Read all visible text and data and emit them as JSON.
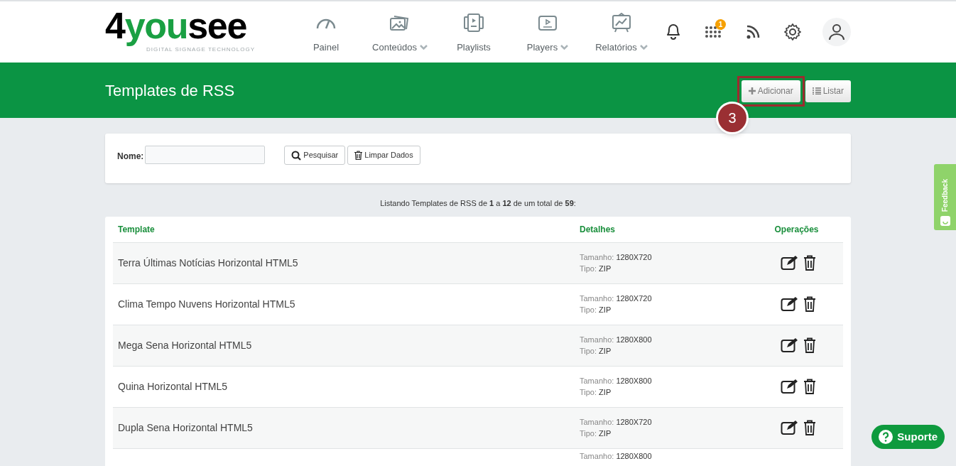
{
  "logo": {
    "brand_start": "4",
    "brand_mid": "you",
    "brand_end": "see",
    "tagline": "DIGITAL SIGNAGE TECHNOLOGY"
  },
  "nav": [
    {
      "label": "Painel",
      "dropdown": false
    },
    {
      "label": "Conteúdos",
      "dropdown": true
    },
    {
      "label": "Playlists",
      "dropdown": false
    },
    {
      "label": "Players",
      "dropdown": true
    },
    {
      "label": "Relatórios",
      "dropdown": true
    }
  ],
  "toolbar": {
    "apps_badge": "1"
  },
  "page_title": "Templates de RSS",
  "header_buttons": [
    {
      "label": "Adicionar",
      "highlighted": true
    },
    {
      "label": "Listar",
      "highlighted": false
    }
  ],
  "callout": {
    "number": "3"
  },
  "search": {
    "label": "Nome:",
    "buttons": [
      "Pesquisar",
      "Limpar Dados"
    ]
  },
  "summary": "Listando Templates de RSS de **1** a **12** de um total de **59**:",
  "table": {
    "columns": [
      "Template",
      "Detalhes",
      "Operações"
    ],
    "rows": [
      {
        "name": "Terra Últimas Notícias Horizontal HTML5",
        "size_label": "Tamanho:",
        "size": "1280X720",
        "type_label": "Tipo:",
        "type": "ZIP"
      },
      {
        "name": "Clima Tempo Nuvens Horizontal HTML5",
        "size_label": "Tamanho:",
        "size": "1280X720",
        "type_label": "Tipo:",
        "type": "ZIP"
      },
      {
        "name": "Mega Sena Horizontal HTML5",
        "size_label": "Tamanho:",
        "size": "1280X800",
        "type_label": "Tipo:",
        "type": "ZIP"
      },
      {
        "name": "Quina Horizontal HTML5",
        "size_label": "Tamanho:",
        "size": "1280X800",
        "type_label": "Tipo:",
        "type": "ZIP"
      },
      {
        "name": "Dupla Sena Horizontal HTML5",
        "size_label": "Tamanho:",
        "size": "1280X720",
        "type_label": "Tipo:",
        "type": "ZIP"
      },
      {
        "size_label": "Tamanho:",
        "size": "1280X800"
      }
    ]
  },
  "feedback_tab": "Feedback",
  "support_button": "Suporte"
}
